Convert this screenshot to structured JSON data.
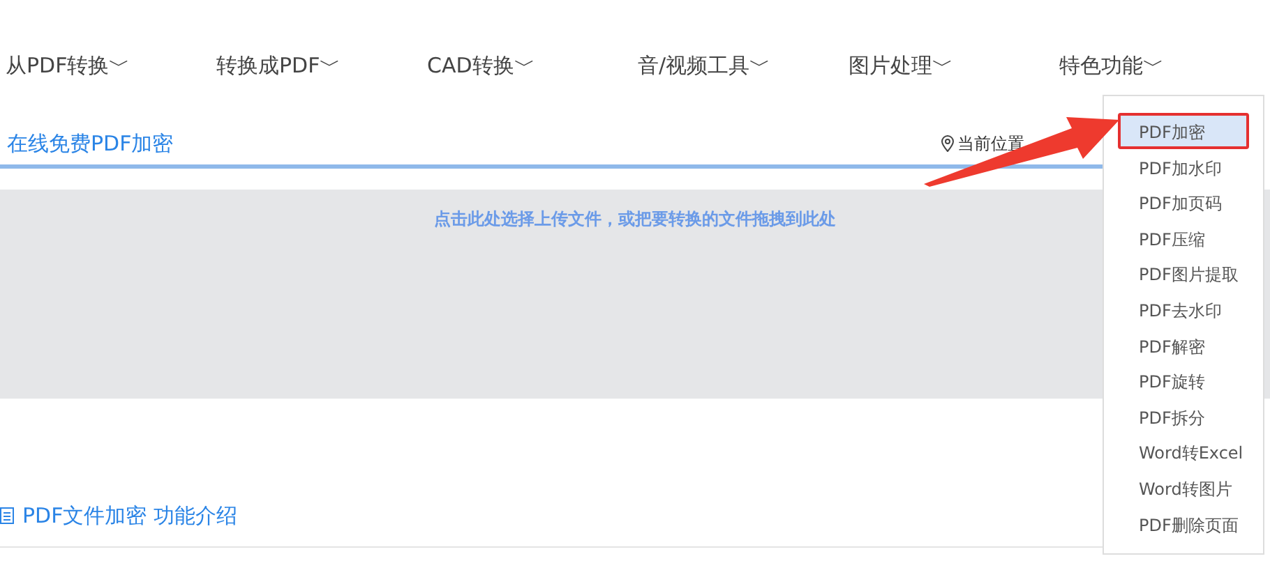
{
  "nav": [
    {
      "label": "从PDF转换",
      "caret": "﹀"
    },
    {
      "label": "转换成PDF",
      "caret": "﹀"
    },
    {
      "label": "CAD转换",
      "caret": "﹀"
    },
    {
      "label": "音/视频工具",
      "caret": "﹀"
    },
    {
      "label": "图片处理",
      "caret": "﹀"
    },
    {
      "label": "特色功能",
      "caret": "﹀"
    }
  ],
  "page_title": "在线免费PDF加密",
  "breadcrumb": "当前位置",
  "upload_hint": "点击此处选择上传文件，或把要转换的文件拖拽到此处",
  "intro_heading": "PDF文件加密 功能介绍",
  "dropdown": [
    {
      "label": "PDF加密",
      "selected": true
    },
    {
      "label": "PDF加水印",
      "selected": false
    },
    {
      "label": "PDF加页码",
      "selected": false
    },
    {
      "label": "PDF压缩",
      "selected": false
    },
    {
      "label": "PDF图片提取",
      "selected": false
    },
    {
      "label": "PDF去水印",
      "selected": false
    },
    {
      "label": "PDF解密",
      "selected": false
    },
    {
      "label": "PDF旋转",
      "selected": false
    },
    {
      "label": "PDF拆分",
      "selected": false
    },
    {
      "label": "Word转Excel",
      "selected": false
    },
    {
      "label": "Word转图片",
      "selected": false
    },
    {
      "label": "PDF删除页面",
      "selected": false
    }
  ]
}
